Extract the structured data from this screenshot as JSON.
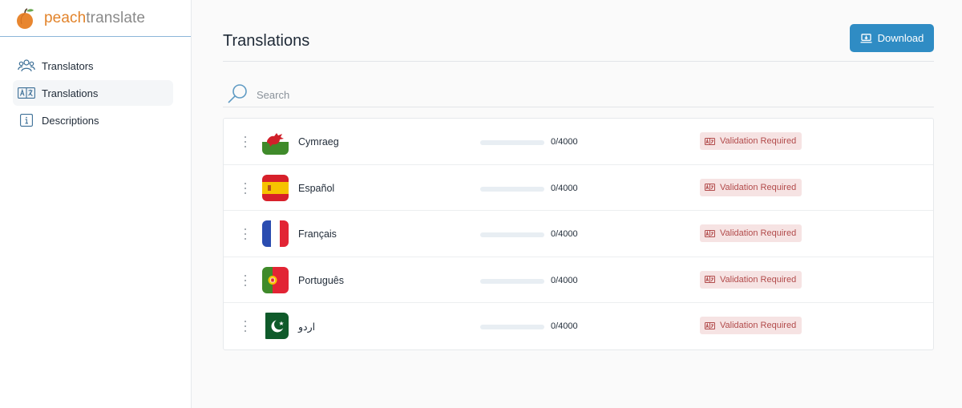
{
  "brand": {
    "part1": "peach",
    "part2": "translate"
  },
  "sidebar": {
    "items": [
      {
        "label": "Translators",
        "icon": "users-icon",
        "active": false
      },
      {
        "label": "Translations",
        "icon": "translate-icon",
        "active": true
      },
      {
        "label": "Descriptions",
        "icon": "info-icon",
        "active": false
      }
    ]
  },
  "header": {
    "title": "Translations",
    "download_label": "Download"
  },
  "search": {
    "placeholder": "Search",
    "value": ""
  },
  "colors": {
    "accent": "#2f8cc4",
    "badge_bg": "#f6e3e3",
    "badge_text": "#b24b4b",
    "brand_orange": "#e2832a"
  },
  "translations": [
    {
      "language": "Cymraeg",
      "flag": "wales-flag-icon",
      "count": "0/4000",
      "progress": 0,
      "status": "Validation Required"
    },
    {
      "language": "Español",
      "flag": "spain-flag-icon",
      "count": "0/4000",
      "progress": 0,
      "status": "Validation Required"
    },
    {
      "language": "Français",
      "flag": "france-flag-icon",
      "count": "0/4000",
      "progress": 0,
      "status": "Validation Required"
    },
    {
      "language": "Português",
      "flag": "portugal-flag-icon",
      "count": "0/4000",
      "progress": 0,
      "status": "Validation Required"
    },
    {
      "language": "اردو",
      "flag": "pakistan-flag-icon",
      "count": "0/4000",
      "progress": 0,
      "status": "Validation Required"
    }
  ]
}
